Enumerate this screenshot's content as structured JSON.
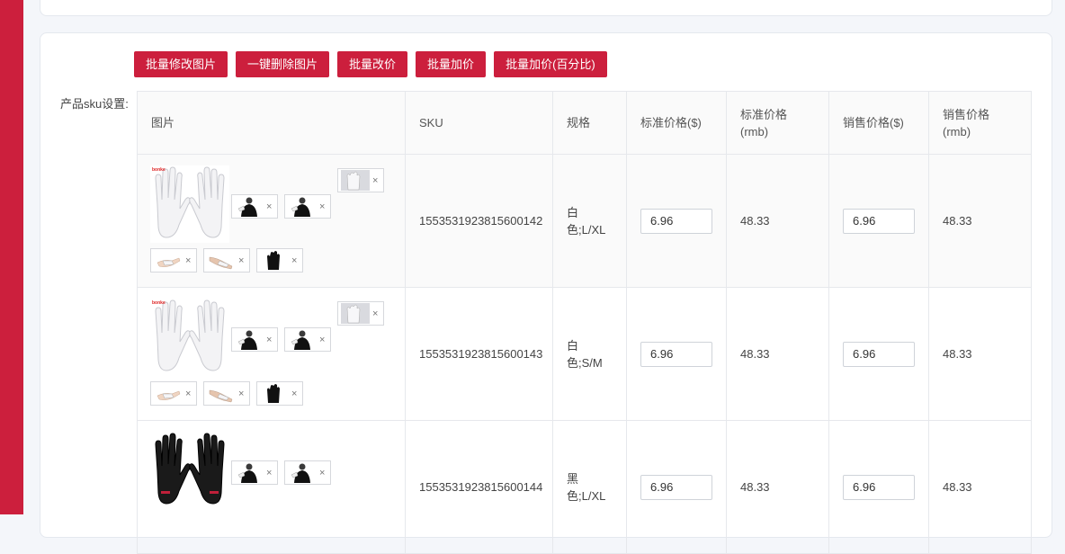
{
  "toolbar": {
    "batch_edit_images": "批量修改图片",
    "delete_all_images": "一键删除图片",
    "batch_edit_price": "批量改价",
    "batch_add_price": "批量加价",
    "batch_add_price_percent": "批量加价(百分比)"
  },
  "sku_settings_label": "产品sku设置:",
  "table": {
    "headers": [
      "图片",
      "SKU",
      "规格",
      "标准价格($)",
      "标准价格(rmb)",
      "销售价格($)",
      "销售价格(rmb)"
    ],
    "remove_mark": "×",
    "rows": [
      {
        "sku": "1553531923815600142",
        "spec": "白色;L/XL",
        "std_usd": "6.96",
        "std_rmb": "48.33",
        "sale_usd": "6.96",
        "sale_rmb": "48.33",
        "glove_color": "white",
        "brand_text": "bonke"
      },
      {
        "sku": "1553531923815600143",
        "spec": "白色;S/M",
        "std_usd": "6.96",
        "std_rmb": "48.33",
        "sale_usd": "6.96",
        "sale_rmb": "48.33",
        "glove_color": "white",
        "brand_text": "bonke"
      },
      {
        "sku": "1553531923815600144",
        "spec": "黑色;L/XL",
        "std_usd": "6.96",
        "std_rmb": "48.33",
        "sale_usd": "6.96",
        "sale_rmb": "48.33",
        "glove_color": "black",
        "brand_text": ""
      }
    ]
  },
  "colors": {
    "accent": "#cc1f3d"
  }
}
